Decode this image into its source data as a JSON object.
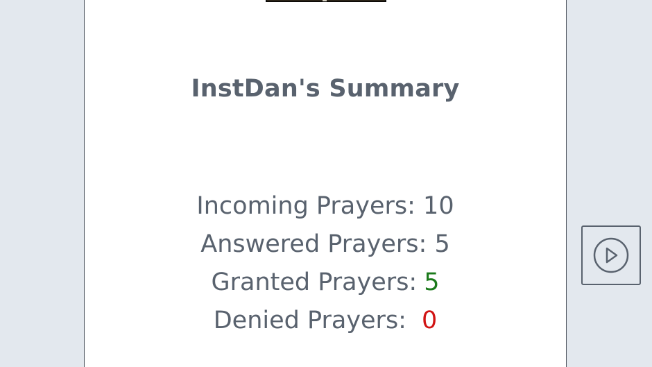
{
  "summary": {
    "title": "InstDan's Summary",
    "stats": [
      {
        "label": "Incoming Prayers:",
        "value": "10"
      },
      {
        "label": "Answered Prayers:",
        "value": "5"
      },
      {
        "label": "Granted Prayers:",
        "value": "5"
      },
      {
        "label": "Denied Prayers:",
        "value": "0"
      }
    ]
  },
  "colors": {
    "text": "#59626e",
    "granted": "#1b7a1b",
    "denied": "#d11414",
    "background": "#e3e8ee",
    "panel": "#ffffff"
  },
  "icons": {
    "play_button": "play-circle-icon"
  }
}
